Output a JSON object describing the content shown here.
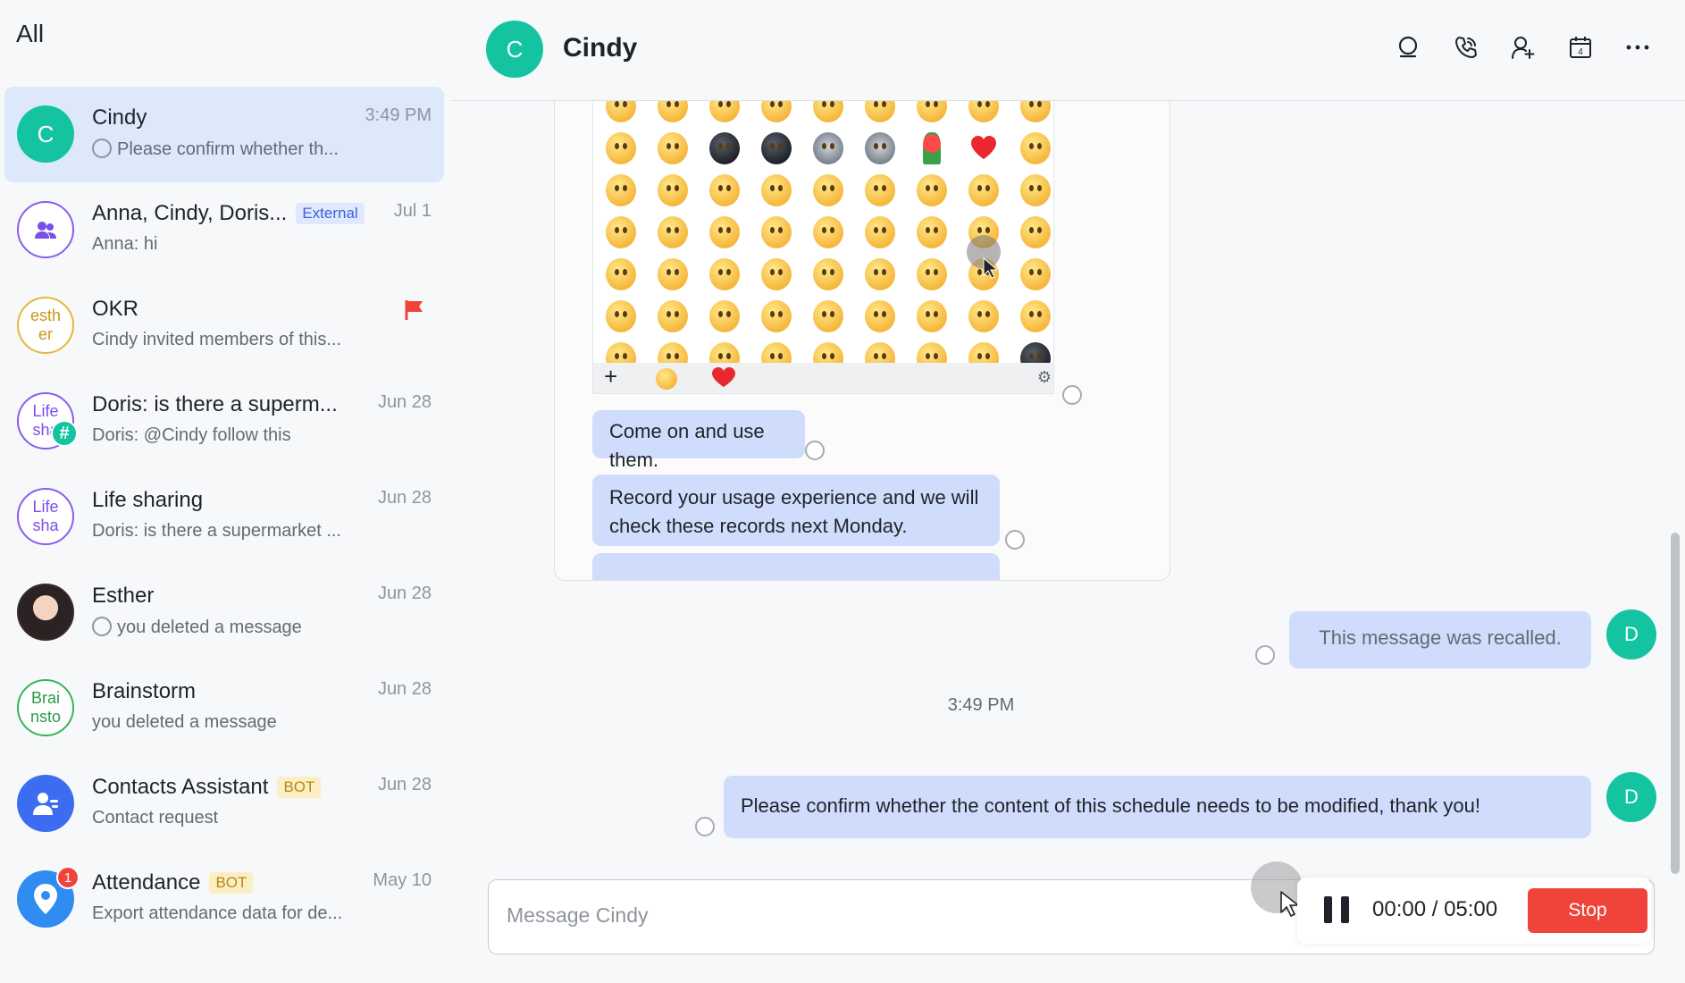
{
  "sidebar": {
    "title": "All",
    "chats": [
      {
        "name": "Cindy",
        "time": "3:49 PM",
        "preview": "Please confirm whether th...",
        "avatar_text": "C"
      },
      {
        "name": "Anna, Cindy, Doris...",
        "tag": "External",
        "time": "Jul 1",
        "preview": "Anna: hi"
      },
      {
        "name": "OKR",
        "preview": "Cindy invited members of this...",
        "avatar_line1": "esth",
        "avatar_line2": "er"
      },
      {
        "name": "Doris: is there a superm...",
        "time": "Jun 28",
        "preview": "Doris: @Cindy follow this",
        "avatar_line1": "Life",
        "avatar_line2": "sha",
        "badge": "#"
      },
      {
        "name": "Life sharing",
        "time": "Jun 28",
        "preview": "Doris: is there a supermarket ...",
        "avatar_line1": "Life",
        "avatar_line2": "sha"
      },
      {
        "name": "Esther",
        "time": "Jun 28",
        "preview": "you deleted a message"
      },
      {
        "name": "Brainstorm",
        "time": "Jun 28",
        "preview": "you deleted a message",
        "avatar_line1": "Brai",
        "avatar_line2": "nsto"
      },
      {
        "name": "Contacts Assistant",
        "tag": "BOT",
        "time": "Jun 28",
        "preview": "Contact request"
      },
      {
        "name": "Attendance",
        "tag": "BOT",
        "time": "May 10",
        "preview": "Export attendance data for de...",
        "badge": "1"
      }
    ]
  },
  "header": {
    "avatar_text": "C",
    "name": "Cindy",
    "icons": [
      "search-icon",
      "phone-icon",
      "add-member-icon",
      "calendar-icon",
      "more-icon"
    ],
    "calendar_day": "4"
  },
  "messages": {
    "incoming_1": "Come on and use them.",
    "incoming_2": "Record your usage experience and we will check these records next Monday.",
    "recalled": "This message was recalled.",
    "timestamp": "3:49 PM",
    "outgoing": "Please confirm whether the content of this schedule needs to be modified, thank you!",
    "my_avatar_text": "D"
  },
  "input": {
    "placeholder": "Message Cindy",
    "record_time": "00:00 / 05:00",
    "stop_label": "Stop"
  },
  "colors": {
    "accent_teal": "#14c4a0",
    "bubble": "#cfdcfb",
    "stop_red": "#f0443a",
    "active_row": "#dde8fb"
  }
}
